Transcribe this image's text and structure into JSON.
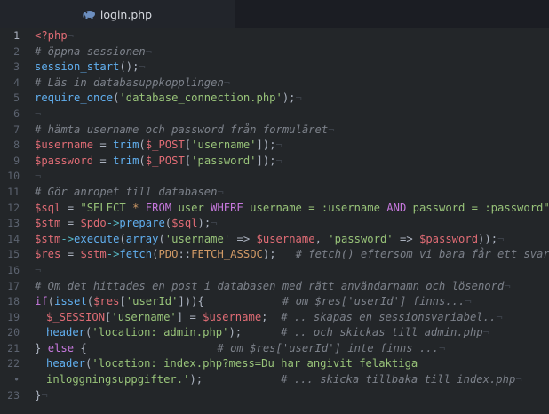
{
  "tab": {
    "label": "login.php",
    "icon": "php-elephant-icon"
  },
  "gutter": [
    "1",
    "2",
    "3",
    "4",
    "5",
    "6",
    "7",
    "8",
    "9",
    "10",
    "11",
    "12",
    "13",
    "14",
    "15",
    "16",
    "17",
    "18",
    "19",
    "20",
    "21",
    "22",
    "•",
    "23"
  ],
  "colors": {
    "background": "#232629",
    "tag": "#e06c75",
    "comment": "#7c818a",
    "function": "#61afef",
    "variable": "#e06c75",
    "string": "#98c379",
    "keyword": "#c678dd",
    "constant": "#d19a66"
  },
  "lines": [
    [
      [
        "tag",
        "<?php"
      ],
      [
        "inv",
        "¬"
      ]
    ],
    [
      [
        "cmt",
        "# öppna sessionen"
      ],
      [
        "inv",
        "¬"
      ]
    ],
    [
      [
        "fn",
        "session_start"
      ],
      [
        "p",
        "();"
      ],
      [
        "inv",
        "¬"
      ]
    ],
    [
      [
        "cmt",
        "# Läs in databasuppkopplingen"
      ],
      [
        "inv",
        "¬"
      ]
    ],
    [
      [
        "fn",
        "require_once"
      ],
      [
        "p",
        "("
      ],
      [
        "str",
        "'database_connection.php'"
      ],
      [
        "p",
        ");"
      ],
      [
        "inv",
        "¬"
      ]
    ],
    [
      [
        "inv",
        "¬"
      ]
    ],
    [
      [
        "cmt",
        "# hämta username och password från formuläret"
      ],
      [
        "inv",
        "¬"
      ]
    ],
    [
      [
        "var",
        "$username"
      ],
      [
        "p",
        " = "
      ],
      [
        "fn",
        "trim"
      ],
      [
        "p",
        "("
      ],
      [
        "var",
        "$_POST"
      ],
      [
        "p",
        "["
      ],
      [
        "str",
        "'username'"
      ],
      [
        "p",
        "]);"
      ],
      [
        "inv",
        "¬"
      ]
    ],
    [
      [
        "var",
        "$password"
      ],
      [
        "p",
        " = "
      ],
      [
        "fn",
        "trim"
      ],
      [
        "p",
        "("
      ],
      [
        "var",
        "$_POST"
      ],
      [
        "p",
        "["
      ],
      [
        "str",
        "'password'"
      ],
      [
        "p",
        "]);"
      ],
      [
        "inv",
        "¬"
      ]
    ],
    [
      [
        "inv",
        "¬"
      ]
    ],
    [
      [
        "cmt",
        "# Gör anropet till databasen"
      ],
      [
        "inv",
        "¬"
      ]
    ],
    [
      [
        "var",
        "$sql"
      ],
      [
        "p",
        " = "
      ],
      [
        "str",
        "\"SELECT "
      ],
      [
        "const",
        "*"
      ],
      [
        "str",
        " "
      ],
      [
        "kw",
        "FROM"
      ],
      [
        "str",
        " user "
      ],
      [
        "kw",
        "WHERE"
      ],
      [
        "str",
        " username = :username "
      ],
      [
        "kw",
        "AND"
      ],
      [
        "str",
        " password = :password\""
      ],
      [
        "p",
        ";"
      ]
    ],
    [
      [
        "var",
        "$stm"
      ],
      [
        "p",
        " = "
      ],
      [
        "var",
        "$pdo"
      ],
      [
        "op",
        "->"
      ],
      [
        "fn",
        "prepare"
      ],
      [
        "p",
        "("
      ],
      [
        "var",
        "$sql"
      ],
      [
        "p",
        ");"
      ],
      [
        "inv",
        "¬"
      ]
    ],
    [
      [
        "var",
        "$stm"
      ],
      [
        "op",
        "->"
      ],
      [
        "fn",
        "execute"
      ],
      [
        "p",
        "("
      ],
      [
        "fn",
        "array"
      ],
      [
        "p",
        "("
      ],
      [
        "str",
        "'username'"
      ],
      [
        "p",
        " => "
      ],
      [
        "var",
        "$username"
      ],
      [
        "p",
        ", "
      ],
      [
        "str",
        "'password'"
      ],
      [
        "p",
        " => "
      ],
      [
        "var",
        "$password"
      ],
      [
        "p",
        "));"
      ],
      [
        "inv",
        "¬"
      ]
    ],
    [
      [
        "var",
        "$res"
      ],
      [
        "p",
        " = "
      ],
      [
        "var",
        "$stm"
      ],
      [
        "op",
        "->"
      ],
      [
        "fn",
        "fetch"
      ],
      [
        "p",
        "("
      ],
      [
        "const",
        "PDO"
      ],
      [
        "p",
        "::"
      ],
      [
        "const",
        "FETCH_ASSOC"
      ],
      [
        "p",
        ");   "
      ],
      [
        "cmt",
        "# fetch() eftersom vi bara får ett svar"
      ],
      [
        "inv",
        "¬"
      ]
    ],
    [
      [
        "inv",
        "¬"
      ]
    ],
    [
      [
        "cmt",
        "# Om det hittades en post i databasen med rätt användarnamn och lösenord"
      ],
      [
        "inv",
        "¬"
      ]
    ],
    [
      [
        "kw",
        "if"
      ],
      [
        "p",
        "("
      ],
      [
        "fn",
        "isset"
      ],
      [
        "p",
        "("
      ],
      [
        "var",
        "$res"
      ],
      [
        "p",
        "["
      ],
      [
        "str",
        "'userId'"
      ],
      [
        "p",
        "])){"
      ],
      [
        "p",
        "            "
      ],
      [
        "cmt",
        "# om $res['userId'] finns..."
      ],
      [
        "inv",
        "¬"
      ]
    ],
    [
      [
        "ind",
        ""
      ],
      [
        "var",
        "$_SESSION"
      ],
      [
        "p",
        "["
      ],
      [
        "str",
        "'username'"
      ],
      [
        "p",
        "] = "
      ],
      [
        "var",
        "$username"
      ],
      [
        "p",
        ";  "
      ],
      [
        "cmt",
        "# .. skapas en sessionsvariabel.."
      ],
      [
        "inv",
        "¬"
      ]
    ],
    [
      [
        "ind",
        ""
      ],
      [
        "fn",
        "header"
      ],
      [
        "p",
        "("
      ],
      [
        "str",
        "'location: admin.php'"
      ],
      [
        "p",
        ");      "
      ],
      [
        "cmt",
        "# .. och skickas till admin.php"
      ],
      [
        "inv",
        "¬"
      ]
    ],
    [
      [
        "p",
        "} "
      ],
      [
        "kw",
        "else"
      ],
      [
        "p",
        " {"
      ],
      [
        "p",
        "                    "
      ],
      [
        "cmt",
        "# om $res['userId'] inte finns ..."
      ],
      [
        "inv",
        "¬"
      ]
    ],
    [
      [
        "ind",
        ""
      ],
      [
        "fn",
        "header"
      ],
      [
        "p",
        "("
      ],
      [
        "str",
        "'location: index.php?mess=Du har angivit felaktiga"
      ]
    ],
    [
      [
        "ind",
        ""
      ],
      [
        "str",
        "inloggningsuppgifter.'"
      ],
      [
        "p",
        ");            "
      ],
      [
        "cmt",
        "# ... skicka tillbaka till index.php"
      ],
      [
        "inv",
        "¬"
      ]
    ],
    [
      [
        "p",
        "}"
      ],
      [
        "inv",
        "¬"
      ]
    ]
  ]
}
